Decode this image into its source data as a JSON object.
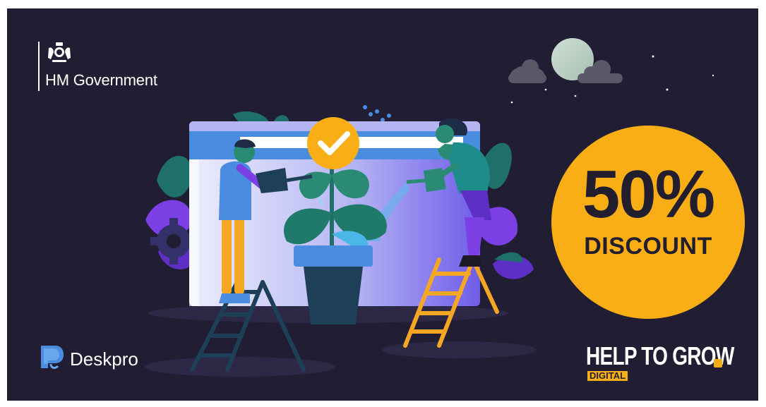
{
  "government": {
    "name": "HM Government"
  },
  "offer": {
    "amount": "50%",
    "label": "DISCOUNT"
  },
  "partner": {
    "name": "Deskpro"
  },
  "programme": {
    "title": "HELP TO GROW",
    "subtitle": "DIGITAL"
  },
  "colors": {
    "background": "#211d33",
    "accent": "#f9ae16",
    "browser_blue": "#4a8de0",
    "plant_green": "#1f6f6a",
    "purple": "#7b3fe4"
  },
  "icons": [
    "crest-icon",
    "checkmark-icon",
    "gear-icon",
    "cloud-icon",
    "moon-icon",
    "deskpro-elephant-icon"
  ]
}
